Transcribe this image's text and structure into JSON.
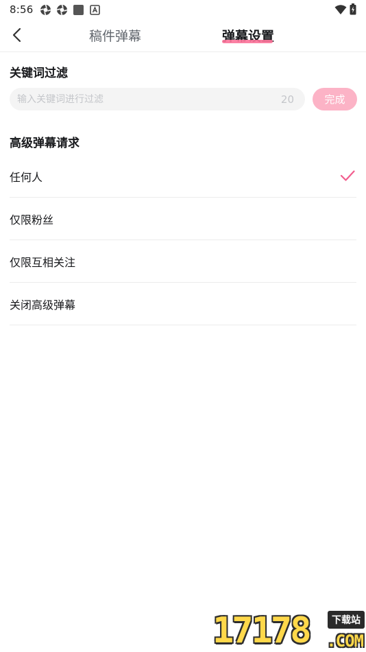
{
  "status_bar": {
    "time": "8:56",
    "icons": [
      "aperture-icon",
      "aperture-icon",
      "square-app-icon",
      "a-badge-icon",
      "wifi-icon",
      "battery-charging-icon"
    ]
  },
  "header": {
    "back_icon": "chevron-left-icon",
    "tabs": [
      {
        "label": "稿件弹幕",
        "active": false
      },
      {
        "label": "弹幕设置",
        "active": true
      }
    ],
    "accent_color": "#fb7299"
  },
  "keyword_filter": {
    "title": "关键词过滤",
    "input_value": "",
    "input_placeholder": "输入关键词进行过滤",
    "count": "20",
    "done_label": "完成",
    "done_color": "#fcb3c6"
  },
  "advanced_danmaku": {
    "title": "高级弹幕请求",
    "options": [
      {
        "label": "任何人",
        "selected": true
      },
      {
        "label": "仅限粉丝",
        "selected": false
      },
      {
        "label": "仅限互相关注",
        "selected": false
      },
      {
        "label": "关闭高级弹幕",
        "selected": false
      }
    ],
    "check_icon": "checkmark-icon",
    "check_color": "#f25d8e"
  },
  "watermark": {
    "number": "17178",
    "tag": "下载站",
    "domain": ".COM"
  }
}
